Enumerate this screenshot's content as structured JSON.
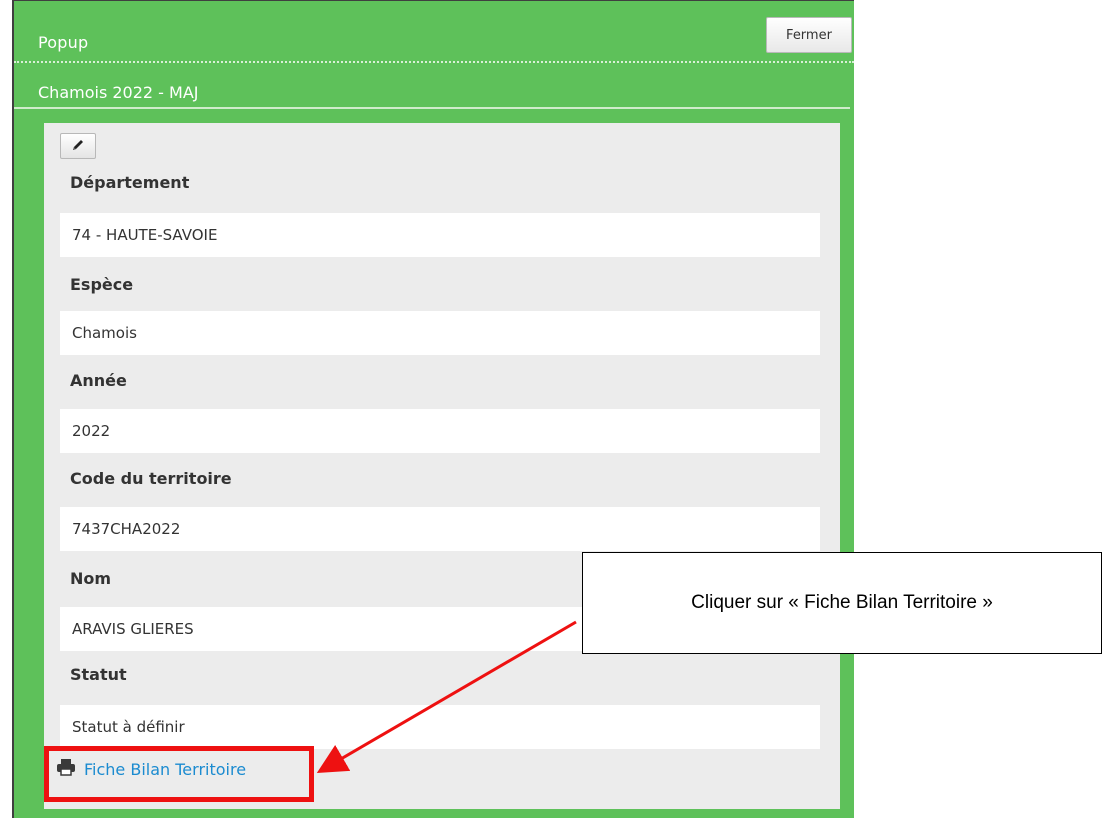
{
  "popup": {
    "title": "Popup",
    "close_label": "Fermer",
    "record_title": "Chamois 2022 - MAJ"
  },
  "form": {
    "edit_icon": "pencil-icon",
    "fields": [
      {
        "label": "Département",
        "value": "74 - HAUTE-SAVOIE"
      },
      {
        "label": "Espèce",
        "value": "Chamois"
      },
      {
        "label": "Année",
        "value": "2022"
      },
      {
        "label": "Code du territoire",
        "value": "7437CHA2022"
      },
      {
        "label": "Nom",
        "value": "ARAVIS GLIERES"
      },
      {
        "label": "Statut",
        "value": "Statut à définir"
      }
    ],
    "print_link_label": "Fiche Bilan Territoire",
    "print_icon": "printer-icon"
  },
  "annotation": {
    "callout_text": "Cliquer sur « Fiche Bilan Territoire »",
    "highlight_color": "#ee1111"
  },
  "colors": {
    "accent_green": "#5ec15a",
    "link_blue": "#1b8bd0"
  }
}
